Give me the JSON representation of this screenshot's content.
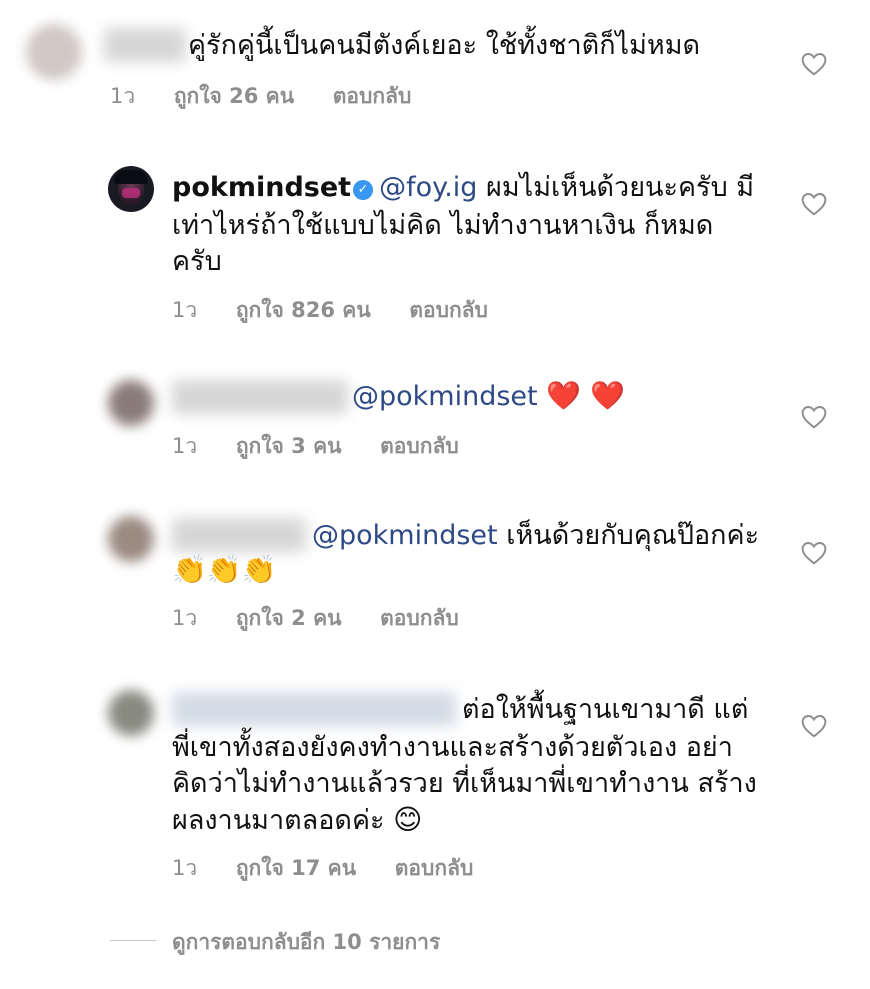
{
  "comments": [
    {
      "text": "คู่รักคู่นี้เป็นคนมีตังค์เยอะ ใช้ทั้งชาติก็ไม่หมด",
      "time": "1ว",
      "likes": "ถูกใจ 26 คน",
      "reply": "ตอบกลับ"
    },
    {
      "username": "pokmindset",
      "mention": "@foy.ig",
      "line1": "ผมไม่เห็นด้วยนะครับ มี",
      "line2": "เท่าไหร่ถ้าใช้แบบไม่คิด ไม่ทำงานหาเงิน ก็หมด",
      "line3": "ครับ",
      "time": "1ว",
      "likes": "ถูกใจ 826 คน",
      "reply": "ตอบกลับ"
    },
    {
      "mention": "@pokmindset",
      "emoji": "❤️ ❤️",
      "time": "1ว",
      "likes": "ถูกใจ 3 คน",
      "reply": "ตอบกลับ"
    },
    {
      "mention": "@pokmindset",
      "line1": "เห็นด้วยกับคุณป๊อกค่ะ",
      "emoji": "👏👏👏",
      "time": "1ว",
      "likes": "ถูกใจ 2 คน",
      "reply": "ตอบกลับ"
    },
    {
      "line1": "ต่อให้พื้นฐานเขามาดี แต่",
      "line2": "พี่เขาทั้งสองยังคงทำงานและสร้างด้วยตัวเอง อย่า",
      "line3": "คิดว่าไม่ทำงานแล้วรวย ที่เห็นมาพี่เขาทำงาน สร้าง",
      "line4": "ผลงานมาตลอดค่ะ",
      "emoji": "😊",
      "time": "1ว",
      "likes": "ถูกใจ 17 คน",
      "reply": "ตอบกลับ"
    }
  ],
  "more_replies": "ดูการตอบกลับอีก 10 รายการ",
  "icons": {
    "like": "heart-outline-icon",
    "verified": "verified-badge-icon"
  },
  "colors": {
    "mention": "#2e4a86",
    "meta": "#8e8e8e",
    "verified": "#3897f0"
  }
}
